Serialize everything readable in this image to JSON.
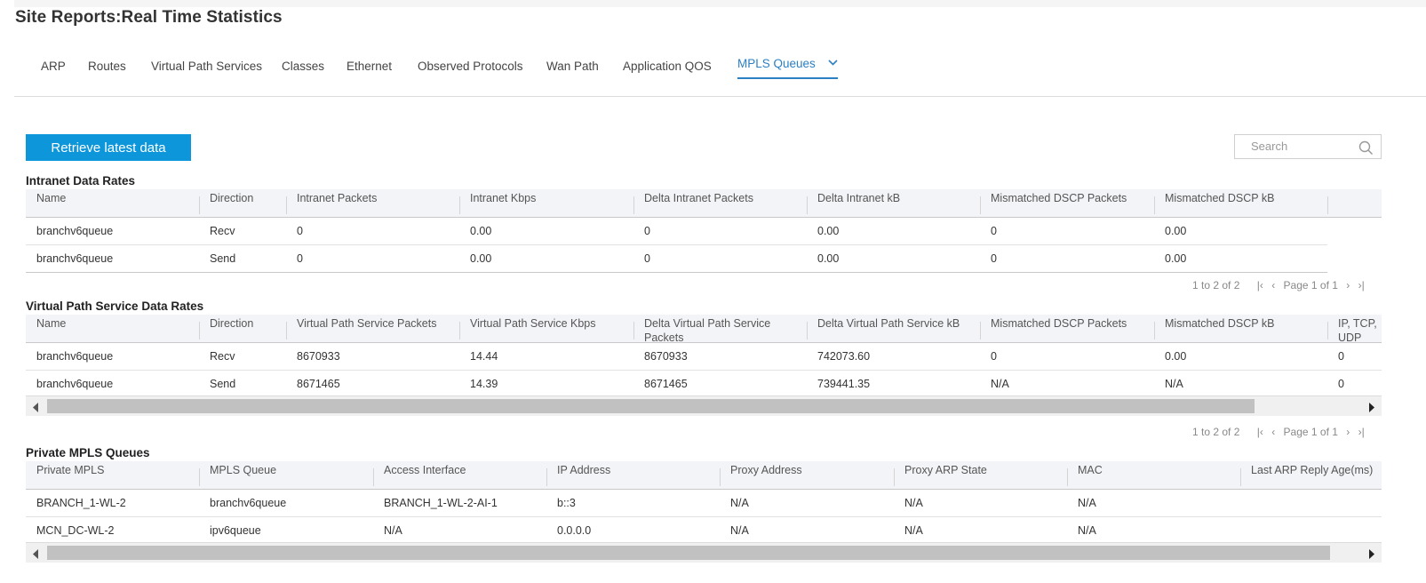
{
  "page_title": "Site Reports:Real Time Statistics",
  "tabs": [
    {
      "label": "ARP"
    },
    {
      "label": "Routes"
    },
    {
      "label": "Virtual Path Services"
    },
    {
      "label": "Classes"
    },
    {
      "label": "Ethernet"
    },
    {
      "label": "Observed Protocols"
    },
    {
      "label": "Wan Path"
    },
    {
      "label": "Application QOS"
    },
    {
      "label": "MPLS Queues",
      "active": true
    }
  ],
  "retrieve_button": "Retrieve latest data",
  "search": {
    "placeholder": "Search",
    "icon": "search-icon"
  },
  "intranet": {
    "title": "Intranet Data Rates",
    "columns": [
      "Name",
      "Direction",
      "Intranet Packets",
      "Intranet Kbps",
      "Delta Intranet Packets",
      "Delta Intranet kB",
      "Mismatched DSCP Packets",
      "Mismatched DSCP kB"
    ],
    "rows": [
      [
        "branchv6queue",
        "Recv",
        "0",
        "0.00",
        "0",
        "0.00",
        "0",
        "0.00"
      ],
      [
        "branchv6queue",
        "Send",
        "0",
        "0.00",
        "0",
        "0.00",
        "0",
        "0.00"
      ]
    ],
    "pager": {
      "range": "1 to 2 of 2",
      "page": "Page 1 of 1"
    }
  },
  "vps": {
    "title": "Virtual Path Service Data Rates",
    "columns": [
      "Name",
      "Direction",
      "Virtual Path Service Packets",
      "Virtual Path Service Kbps",
      "Delta Virtual Path Service Packets",
      "Delta Virtual Path Service kB",
      "Mismatched DSCP Packets",
      "Mismatched DSCP kB",
      "IP, TCP, UDP Compression"
    ],
    "rows": [
      [
        "branchv6queue",
        "Recv",
        "8670933",
        "14.44",
        "8670933",
        "742073.60",
        "0",
        "0.00",
        "0"
      ],
      [
        "branchv6queue",
        "Send",
        "8671465",
        "14.39",
        "8671465",
        "739441.35",
        "N/A",
        "N/A",
        "0"
      ]
    ],
    "pager": {
      "range": "1 to 2 of 2",
      "page": "Page 1 of 1"
    }
  },
  "mpls": {
    "title": "Private MPLS Queues",
    "columns": [
      "Private MPLS",
      "MPLS Queue",
      "Access Interface",
      "IP Address",
      "Proxy Address",
      "Proxy ARP State",
      "MAC",
      "Last ARP Reply Age(ms)"
    ],
    "rows": [
      [
        "BRANCH_1-WL-2",
        "branchv6queue",
        "BRANCH_1-WL-2-AI-1",
        "b::3",
        "N/A",
        "N/A",
        "N/A",
        ""
      ],
      [
        "MCN_DC-WL-2",
        "ipv6queue",
        "N/A",
        "0.0.0.0",
        "N/A",
        "N/A",
        "N/A",
        ""
      ]
    ]
  },
  "colors": {
    "accent": "#0e96db",
    "active_tab": "#2b7fc3"
  }
}
